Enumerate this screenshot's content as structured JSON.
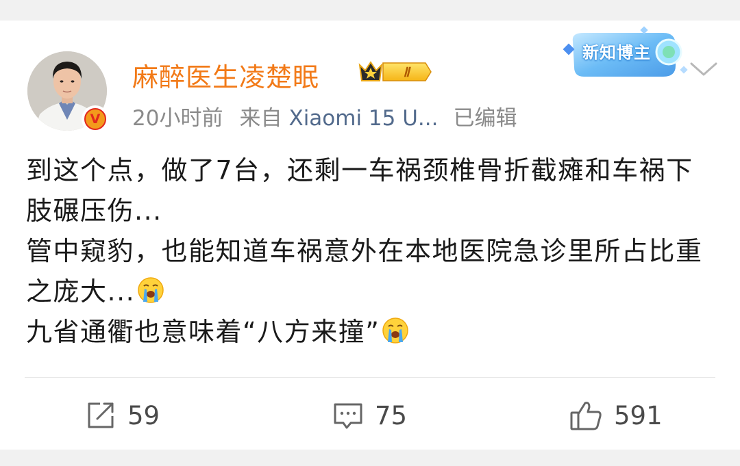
{
  "post": {
    "author": {
      "name": "麻醉医生凌楚眠",
      "vip_level": "Ⅱ",
      "verified_mark": "V",
      "badge_text": "新知博主"
    },
    "meta": {
      "time": "20小时前",
      "source_prefix": "来自",
      "source_device": "Xiaomi 15 U...",
      "edited": "已编辑"
    },
    "content": {
      "line1": "到这个点，做了7台，还剩一车祸颈椎骨折截瘫和车祸下肢碾压伤...",
      "line2": "管中窥豹，也能知道车祸意外在本地医院急诊里所占比重之庞大...",
      "line3": "九省通衢也意味着“八方来撞”",
      "emoji_1": "crying-face",
      "emoji_2": "crying-face"
    },
    "actions": {
      "repost_count": "59",
      "comment_count": "75",
      "like_count": "591"
    },
    "colors": {
      "username": "#f27a18",
      "meta": "#8a8a8a",
      "text": "#1a1a1a"
    },
    "icons": {
      "menu": "chevron-down-icon",
      "repost": "repost-icon",
      "comment": "comment-icon",
      "like": "thumbs-up-icon"
    }
  }
}
